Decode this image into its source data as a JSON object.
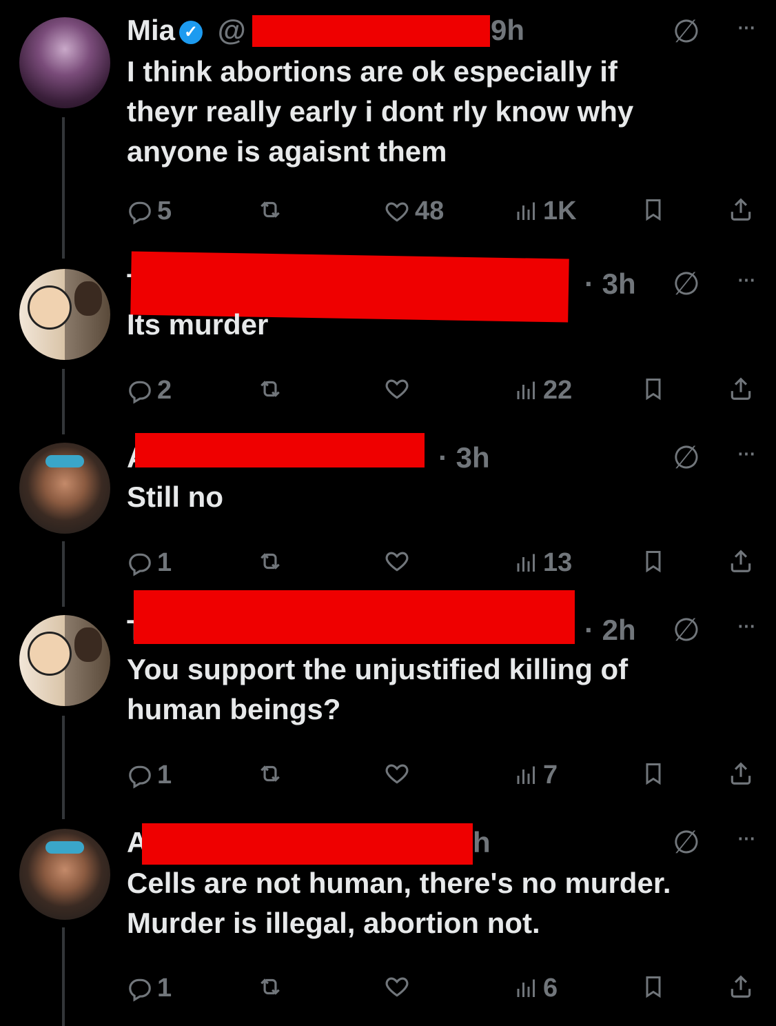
{
  "colors": {
    "background": "#000000",
    "text": "#e7e9ea",
    "muted": "#71767b",
    "verified": "#1d9bf0",
    "redaction": "#ef0000"
  },
  "tweets": [
    {
      "name": "Mia",
      "handle": "@",
      "time": "9h",
      "text": "I think abortions are ok especially if theyr really early i dont rly know why anyone is agaisnt them",
      "replies": "5",
      "retweets": "",
      "likes": "48",
      "views": "1K"
    },
    {
      "name": "T",
      "handle": "",
      "time": "· 3h",
      "text": "Its murder",
      "replies": "2",
      "retweets": "",
      "likes": "",
      "views": "22"
    },
    {
      "name": "A",
      "handle": "",
      "time": "· 3h",
      "text": "Still no",
      "replies": "1",
      "retweets": "",
      "likes": "",
      "views": "13"
    },
    {
      "name": "T",
      "handle": "",
      "time": "· 2h",
      "text": "You support the unjustified killing of human beings?",
      "replies": "1",
      "retweets": "",
      "likes": "",
      "views": "7"
    },
    {
      "name": "A",
      "handle": "",
      "time": "h",
      "text": "Cells are not human, there's no murder. Murder is illegal, abortion not.",
      "replies": "1",
      "retweets": "",
      "likes": "",
      "views": "6"
    }
  ]
}
